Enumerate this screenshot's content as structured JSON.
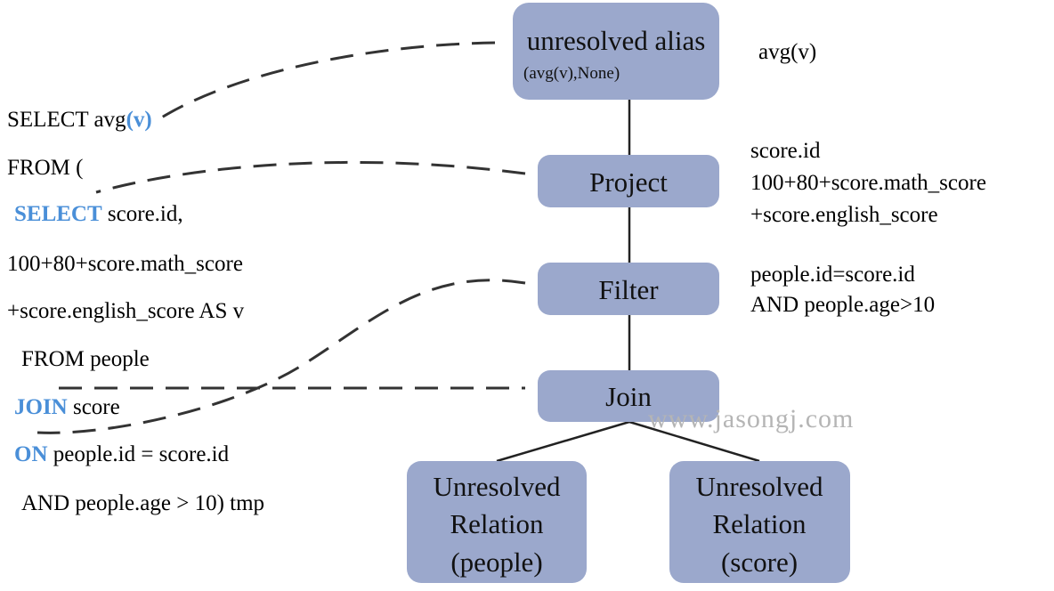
{
  "sql": {
    "line1": {
      "a": "SELECT avg",
      "kw": "(v)"
    },
    "line2": "FROM (",
    "line3": {
      "kw": "SELECT",
      "b": " score.id,"
    },
    "line4": "100+80+score.math_score",
    "line5": "+score.english_score AS v",
    "line6": "FROM people",
    "line7": {
      "kw": "JOIN",
      "b": " score"
    },
    "line8": {
      "kw": "ON",
      "b": " people.id = score.id"
    },
    "line9": "AND people.age > 10) tmp"
  },
  "nodes": {
    "alias": {
      "title": "unresolved alias",
      "sub": "(avg(v),None)",
      "note": "avg(v)"
    },
    "project": {
      "title": "Project",
      "note": [
        "score.id",
        "100+80+score.math_score",
        "+score.english_score"
      ]
    },
    "filter": {
      "title": "Filter",
      "note": [
        "people.id=score.id",
        "AND people.age>10"
      ]
    },
    "join": {
      "title": "Join"
    },
    "people": {
      "lines": [
        "Unresolved",
        "Relation",
        "(people)"
      ]
    },
    "score": {
      "lines": [
        "Unresolved",
        "Relation",
        "(score)"
      ]
    }
  },
  "watermark": "www.jasongj.com",
  "colors": {
    "node_fill": "#9ba8cc",
    "keyword": "#4a8fd8"
  }
}
